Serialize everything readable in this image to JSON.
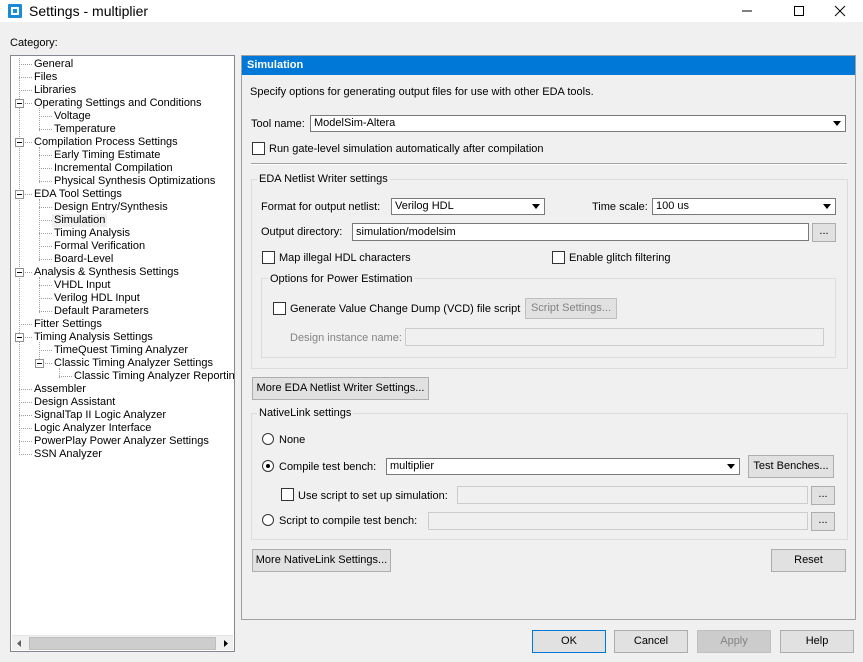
{
  "window": {
    "title": "Settings - multiplier"
  },
  "category_label": "Category:",
  "tree": [
    {
      "label": "General",
      "level": 0,
      "selected": false
    },
    {
      "label": "Files",
      "level": 0,
      "selected": false
    },
    {
      "label": "Libraries",
      "level": 0,
      "selected": false
    },
    {
      "label": "Operating Settings and Conditions",
      "level": 0,
      "expanded": true,
      "selected": false
    },
    {
      "label": "Voltage",
      "level": 1,
      "selected": false
    },
    {
      "label": "Temperature",
      "level": 1,
      "selected": false
    },
    {
      "label": "Compilation Process Settings",
      "level": 0,
      "expanded": true,
      "selected": false
    },
    {
      "label": "Early Timing Estimate",
      "level": 1,
      "selected": false
    },
    {
      "label": "Incremental Compilation",
      "level": 1,
      "selected": false
    },
    {
      "label": "Physical Synthesis Optimizations",
      "level": 1,
      "selected": false
    },
    {
      "label": "EDA Tool Settings",
      "level": 0,
      "expanded": true,
      "selected": false
    },
    {
      "label": "Design Entry/Synthesis",
      "level": 1,
      "selected": false
    },
    {
      "label": "Simulation",
      "level": 1,
      "selected": true
    },
    {
      "label": "Timing Analysis",
      "level": 1,
      "selected": false
    },
    {
      "label": "Formal Verification",
      "level": 1,
      "selected": false
    },
    {
      "label": "Board-Level",
      "level": 1,
      "selected": false
    },
    {
      "label": "Analysis & Synthesis Settings",
      "level": 0,
      "expanded": true,
      "selected": false
    },
    {
      "label": "VHDL Input",
      "level": 1,
      "selected": false
    },
    {
      "label": "Verilog HDL Input",
      "level": 1,
      "selected": false
    },
    {
      "label": "Default Parameters",
      "level": 1,
      "selected": false
    },
    {
      "label": "Fitter Settings",
      "level": 0,
      "selected": false
    },
    {
      "label": "Timing Analysis Settings",
      "level": 0,
      "expanded": true,
      "selected": false
    },
    {
      "label": "TimeQuest Timing Analyzer",
      "level": 1,
      "selected": false
    },
    {
      "label": "Classic Timing Analyzer Settings",
      "level": 1,
      "expanded": true,
      "selected": false
    },
    {
      "label": "Classic Timing Analyzer Reporting",
      "level": 2,
      "selected": false
    },
    {
      "label": "Assembler",
      "level": 0,
      "selected": false
    },
    {
      "label": "Design Assistant",
      "level": 0,
      "selected": false
    },
    {
      "label": "SignalTap II Logic Analyzer",
      "level": 0,
      "selected": false
    },
    {
      "label": "Logic Analyzer Interface",
      "level": 0,
      "selected": false
    },
    {
      "label": "PowerPlay Power Analyzer Settings",
      "level": 0,
      "selected": false
    },
    {
      "label": "SSN Analyzer",
      "level": 0,
      "selected": false
    }
  ],
  "panel": {
    "header": "Simulation",
    "description": "Specify options for generating output files for use with other EDA tools.",
    "tool_name_label": "Tool name:",
    "tool_name_value": "ModelSim-Altera",
    "run_gate_level_label": "Run gate-level simulation automatically after compilation",
    "run_gate_level_checked": false,
    "eda_group_title": "EDA Netlist Writer settings",
    "format_label": "Format for output netlist:",
    "format_value": "Verilog HDL",
    "time_scale_label": "Time scale:",
    "time_scale_value": "100 us",
    "output_dir_label": "Output directory:",
    "output_dir_value": "simulation/modelsim",
    "browse_label": "...",
    "map_illegal_label": "Map illegal HDL characters",
    "map_illegal_checked": false,
    "glitch_label": "Enable glitch filtering",
    "glitch_checked": false,
    "power_group_title": "Options for Power Estimation",
    "vcd_label": "Generate Value Change Dump (VCD) file script",
    "vcd_checked": false,
    "script_settings_label": "Script Settings...",
    "design_instance_label": "Design instance name:",
    "design_instance_value": "",
    "more_eda_label": "More EDA Netlist Writer Settings...",
    "nativelink_group_title": "NativeLink settings",
    "none_label": "None",
    "compile_tb_label": "Compile test bench:",
    "compile_tb_value": "multiplier",
    "test_benches_label": "Test Benches...",
    "use_script_label": "Use script to set up simulation:",
    "use_script_value": "",
    "script_compile_label": "Script to compile test bench:",
    "script_compile_value": "",
    "more_nativelink_label": "More NativeLink Settings...",
    "reset_label": "Reset",
    "selected_nativelink_option": "Compile test bench:"
  },
  "footer": {
    "ok": "OK",
    "cancel": "Cancel",
    "apply": "Apply",
    "help": "Help"
  },
  "colors": {
    "accent": "#0078d7",
    "background": "#f0f0f0"
  }
}
